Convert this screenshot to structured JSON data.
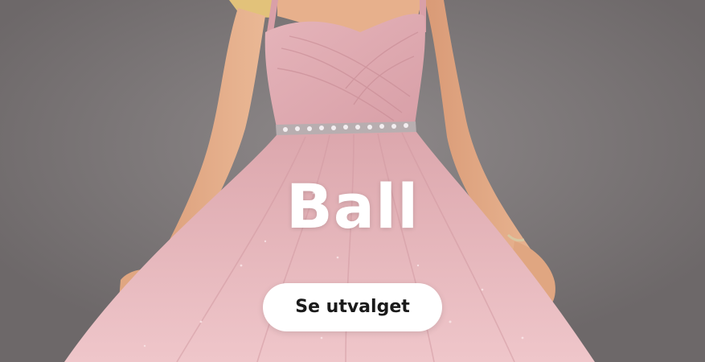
{
  "banner": {
    "title": "Ball",
    "cta_label": "Se utvalget",
    "colors": {
      "background": "#8a8586",
      "dress": "#e8b7bd",
      "skin": "#e7b08c",
      "hair": "#e2c27a",
      "text": "#ffffff",
      "button_bg": "#ffffff",
      "button_text": "#1a1a1a"
    }
  }
}
